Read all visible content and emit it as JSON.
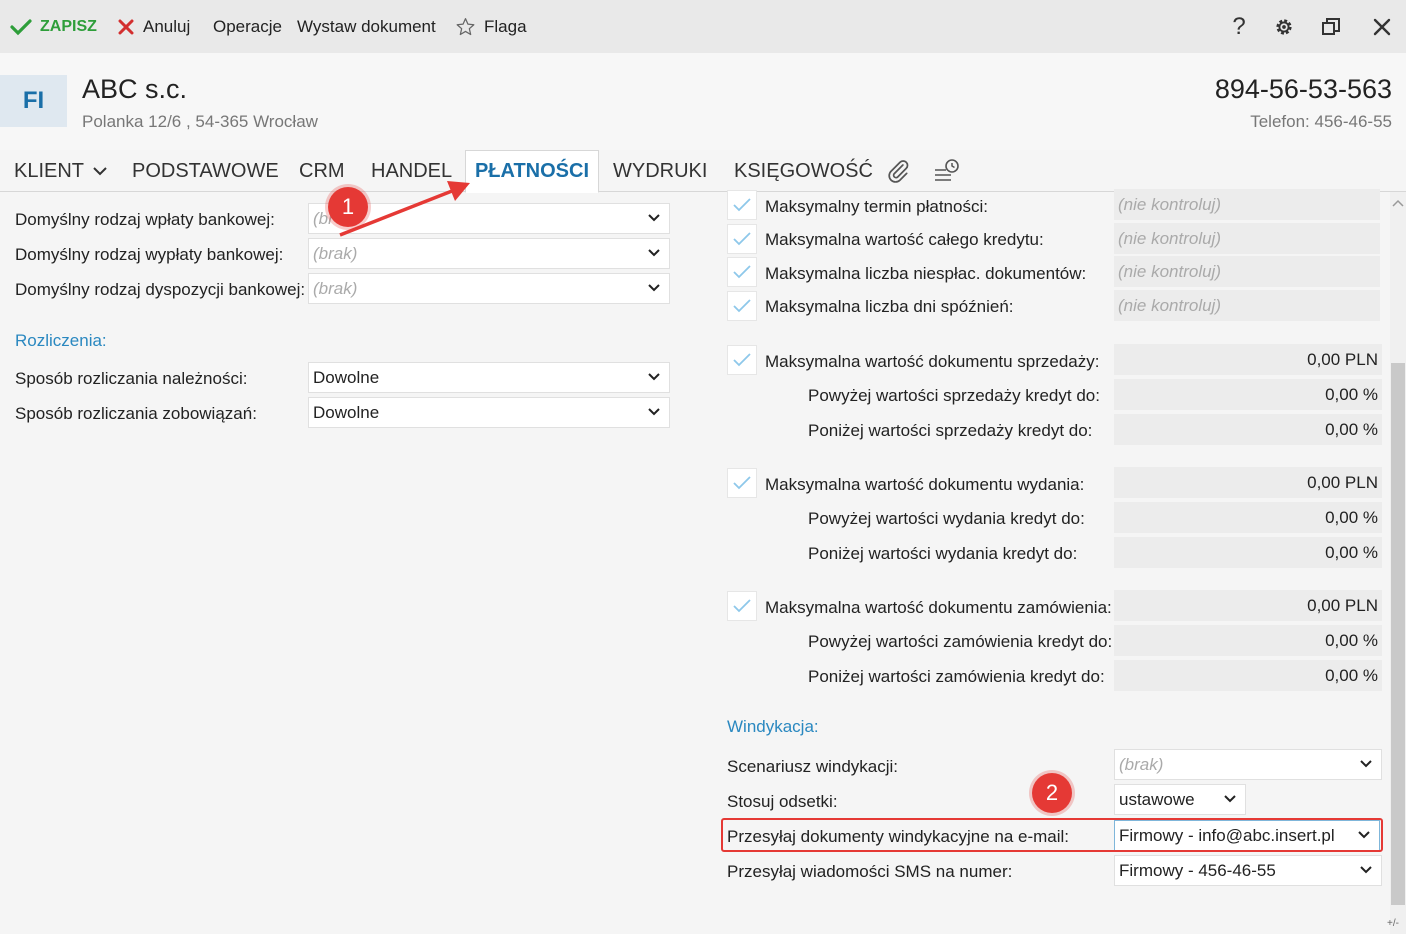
{
  "toolbar": {
    "save": "ZAPISZ",
    "cancel": "Anuluj",
    "operations": "Operacje",
    "issue_document": "Wystaw dokument",
    "flag": "Flaga"
  },
  "header": {
    "badge": "FI",
    "company_name": "ABC s.c.",
    "address": "Polanka  12/6 , 54-365 Wrocław",
    "nip": "894-56-53-563",
    "phone": "Telefon: 456-46-55"
  },
  "tabs": [
    {
      "label": "KLIENT"
    },
    {
      "label": "PODSTAWOWE"
    },
    {
      "label": "CRM"
    },
    {
      "label": "HANDEL"
    },
    {
      "label": "PŁATNOŚCI"
    },
    {
      "label": "WYDRUKI"
    },
    {
      "label": "KSIĘGOWOŚĆ"
    }
  ],
  "left_panel": {
    "rows": [
      {
        "label": "Domyślny rodzaj wpłaty bankowej:",
        "value": "(br"
      },
      {
        "label": "Domyślny rodzaj wypłaty bankowej:",
        "value": "(brak)"
      },
      {
        "label": "Domyślny rodzaj dyspozycji bankowej:",
        "value": "(brak)"
      }
    ],
    "section_label": "Rozliczenia:",
    "settlement_rows": [
      {
        "label": "Sposób rozliczania należności:",
        "value": "Dowolne"
      },
      {
        "label": "Sposób rozliczania zobowiązań:",
        "value": "Dowolne"
      }
    ]
  },
  "right_panel": {
    "limits": [
      {
        "label": "Maksymalny termin płatności:",
        "value": "(nie kontroluj)"
      },
      {
        "label": "Maksymalna wartość całego kredytu:",
        "value": "(nie kontroluj)"
      },
      {
        "label": "Maksymalna liczba niespłac. dokumentów:",
        "value": "(nie kontroluj)"
      },
      {
        "label": "Maksymalna liczba dni spóźnień:",
        "value": "(nie kontroluj)"
      }
    ],
    "groups": [
      {
        "label": "Maksymalna wartość dokumentu sprzedaży:",
        "value": "0,00 PLN",
        "above_label": "Powyżej wartości sprzedaży kredyt do:",
        "above_value": "0,00 %",
        "below_label": "Poniżej wartości sprzedaży kredyt do:",
        "below_value": "0,00 %"
      },
      {
        "label": "Maksymalna wartość dokumentu wydania:",
        "value": "0,00 PLN",
        "above_label": "Powyżej wartości wydania kredyt do:",
        "above_value": "0,00 %",
        "below_label": "Poniżej wartości wydania kredyt do:",
        "below_value": "0,00 %"
      },
      {
        "label": "Maksymalna wartość dokumentu zamówienia:",
        "value": "0,00 PLN",
        "above_label": "Powyżej wartości zamówienia kredyt do:",
        "above_value": "0,00 %",
        "below_label": "Poniżej wartości zamówienia kredyt do:",
        "below_value": "0,00 %"
      }
    ],
    "windykacja": {
      "section_label": "Windykacja:",
      "scenario_label": "Scenariusz windykacji:",
      "scenario_value": "(brak)",
      "interest_label": "Stosuj odsetki:",
      "interest_value": "ustawowe",
      "email_label": "Przesyłaj dokumenty windykacyjne na e-mail:",
      "email_value": "Firmowy - info@abc.insert.pl",
      "sms_label": "Przesyłaj wiadomości SMS na numer:",
      "sms_value": "Firmowy - 456-46-55"
    }
  },
  "annotations": {
    "callout_1": "1",
    "callout_2": "2",
    "accent_color": "#e53935"
  },
  "footer": {
    "corner_mark": "+/-"
  }
}
